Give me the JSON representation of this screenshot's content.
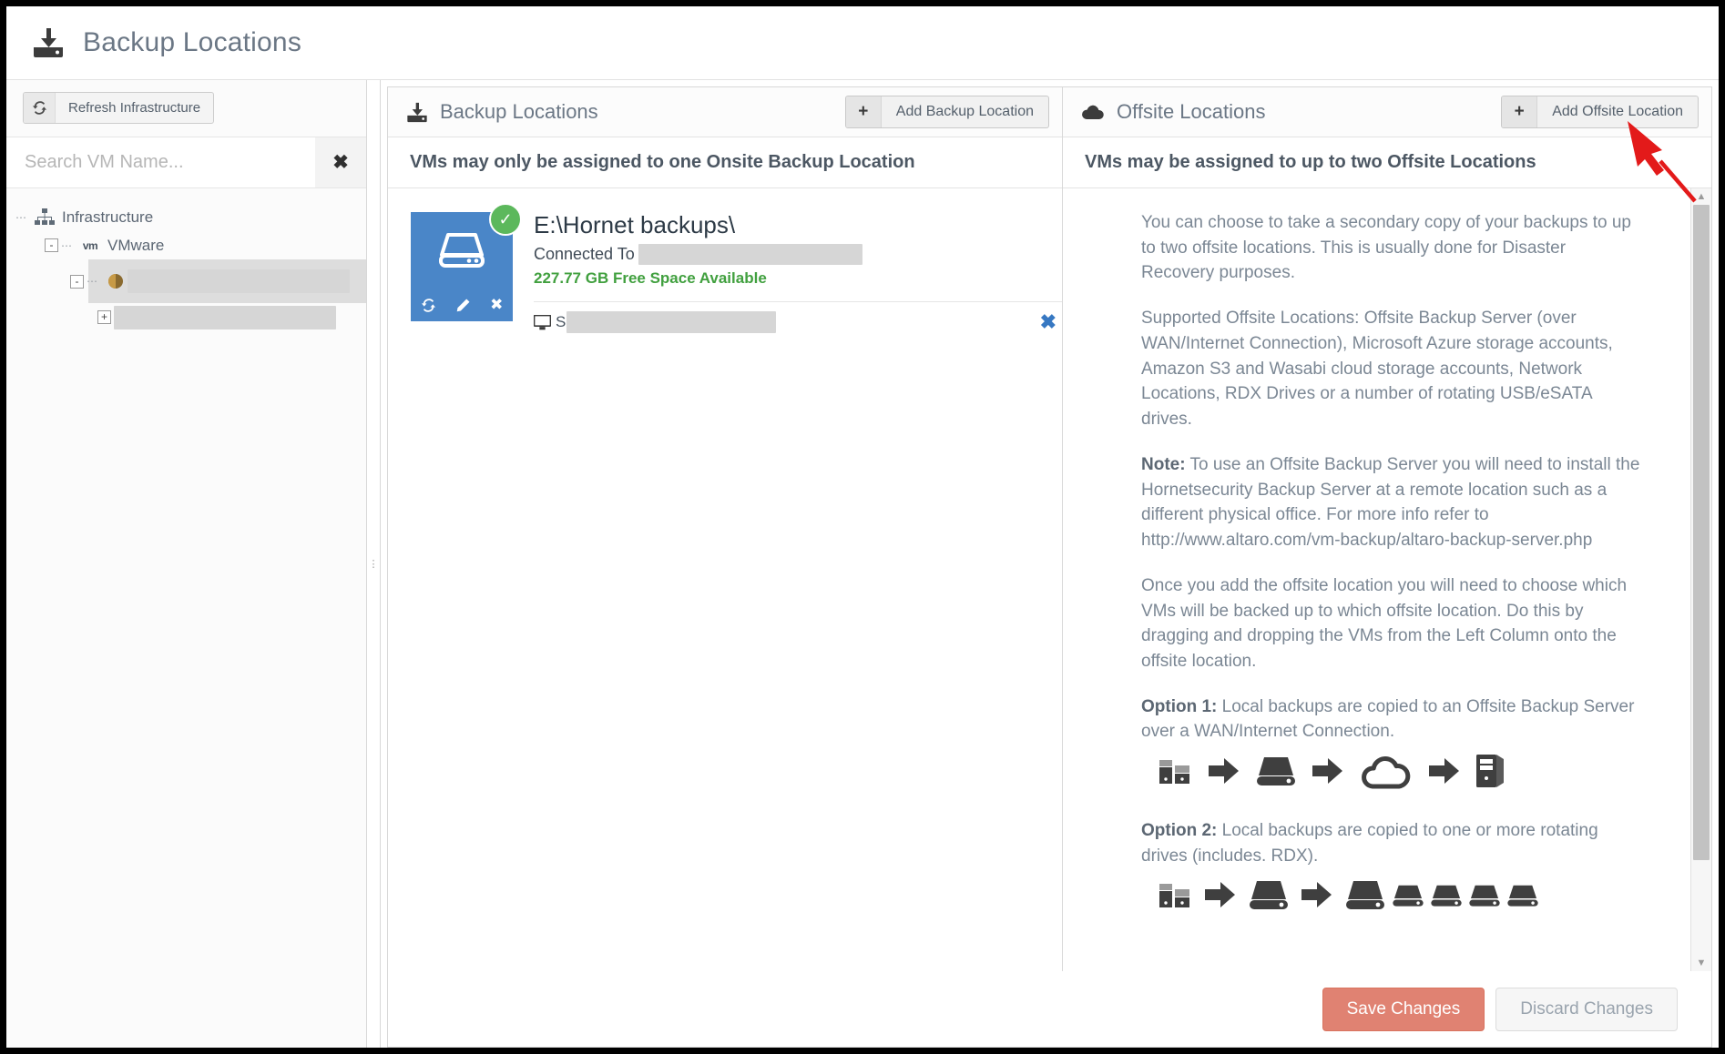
{
  "window": {
    "title": "Backup Locations",
    "title_icon": "backup-download-icon"
  },
  "sidebar": {
    "refresh_button": "Refresh Infrastructure",
    "refresh_icon": "refresh-icon",
    "search": {
      "placeholder": "Search VM Name...",
      "value": "",
      "clear_icon": "clear-x-icon"
    },
    "tree": [
      {
        "label": "Infrastructure",
        "icon": "sitemap-icon",
        "expander": "",
        "redacted": false
      },
      {
        "label": "VMware",
        "icon": "vmware-icon",
        "expander": "-",
        "redacted": false
      },
      {
        "label": "",
        "icon": "host-icon",
        "expander": "-",
        "redacted": true,
        "redact_width": 244
      },
      {
        "label": "",
        "icon": "",
        "expander": "+",
        "redacted": true,
        "redact_width": 244
      }
    ]
  },
  "center_panel": {
    "header_title": "Backup Locations",
    "header_icon": "backup-download-icon",
    "add_button": "Add Backup Location",
    "add_icon": "plus-icon",
    "subheading": "VMs may only be assigned to one Onsite Backup Location",
    "location": {
      "name": "E:\\Hornet backups\\",
      "connected_label": "Connected To",
      "connected_value_redacted": true,
      "free_space": "227.77 GB Free Space Available",
      "status_icon": "check-circle-icon",
      "drive_icon": "hard-drive-icon",
      "actions": [
        {
          "name": "rescan",
          "icon": "refresh-icon"
        },
        {
          "name": "edit",
          "icon": "pencil-icon"
        },
        {
          "name": "delete",
          "icon": "x-icon"
        }
      ],
      "assigned_vm": {
        "icon": "monitor-icon",
        "name_prefix": "S",
        "name_redacted": true,
        "remove_icon": "x-icon"
      }
    }
  },
  "right_panel": {
    "header_title": "Offsite Locations",
    "header_icon": "cloud-upload-icon",
    "add_button": "Add Offsite Location",
    "add_icon": "plus-icon",
    "subheading": "VMs may be assigned to up to two Offsite Locations",
    "paragraphs": [
      "You can choose to take a secondary copy of your backups to up to two offsite locations. This is usually done for Disaster Recovery purposes.",
      "Supported Offsite Locations: Offsite Backup Server (over WAN/Internet Connection), Microsoft Azure storage accounts, Amazon S3 and Wasabi cloud storage accounts, Network Locations, RDX Drives or a number of rotating USB/eSATA drives."
    ],
    "note": {
      "label": "Note:",
      "text": " To use an Offsite Backup Server you will need to install the Hornetsecurity Backup Server at a remote location such as a different physical office. For more info refer to http://www.altaro.com/vm-backup/altaro-backup-server.php"
    },
    "paragraph_3": "Once you add the offsite location you will need to choose which VMs will be backed up to which offsite location. Do this by dragging and dropping the VMs from the Left Column onto the offsite location.",
    "option1": {
      "label": "Option 1:",
      "text": " Local backups are copied to an Offsite Backup Server over a WAN/Internet Connection."
    },
    "option1_flow": [
      "servers-icon",
      "arrow-right-icon",
      "hard-drive-icon",
      "arrow-right-icon",
      "cloud-icon",
      "arrow-right-icon",
      "server-tower-icon"
    ],
    "option2": {
      "label": "Option 2:",
      "text": " Local backups are copied to one or more rotating drives (includes. RDX)."
    },
    "option2_flow": [
      "servers-icon",
      "arrow-right-icon",
      "hard-drive-icon",
      "arrow-right-icon",
      "hard-drive-icon",
      "hard-drive-small-icon",
      "hard-drive-small-icon",
      "hard-drive-small-icon",
      "hard-drive-small-icon"
    ],
    "scrollbar": {
      "up_icon": "caret-up-icon",
      "down_icon": "caret-down-icon"
    }
  },
  "footer": {
    "save_label": "Save Changes",
    "discard_label": "Discard Changes"
  },
  "annotation": {
    "arrow_color": "#e31a1a",
    "points_at": "Add Offsite Location"
  },
  "colors": {
    "accent_blue": "#4a86c8",
    "success_green": "#5cb85c",
    "free_space_green": "#41a03f",
    "save_red": "#e08272",
    "title_grey": "#6b7785",
    "body_grey": "#7b8794"
  }
}
